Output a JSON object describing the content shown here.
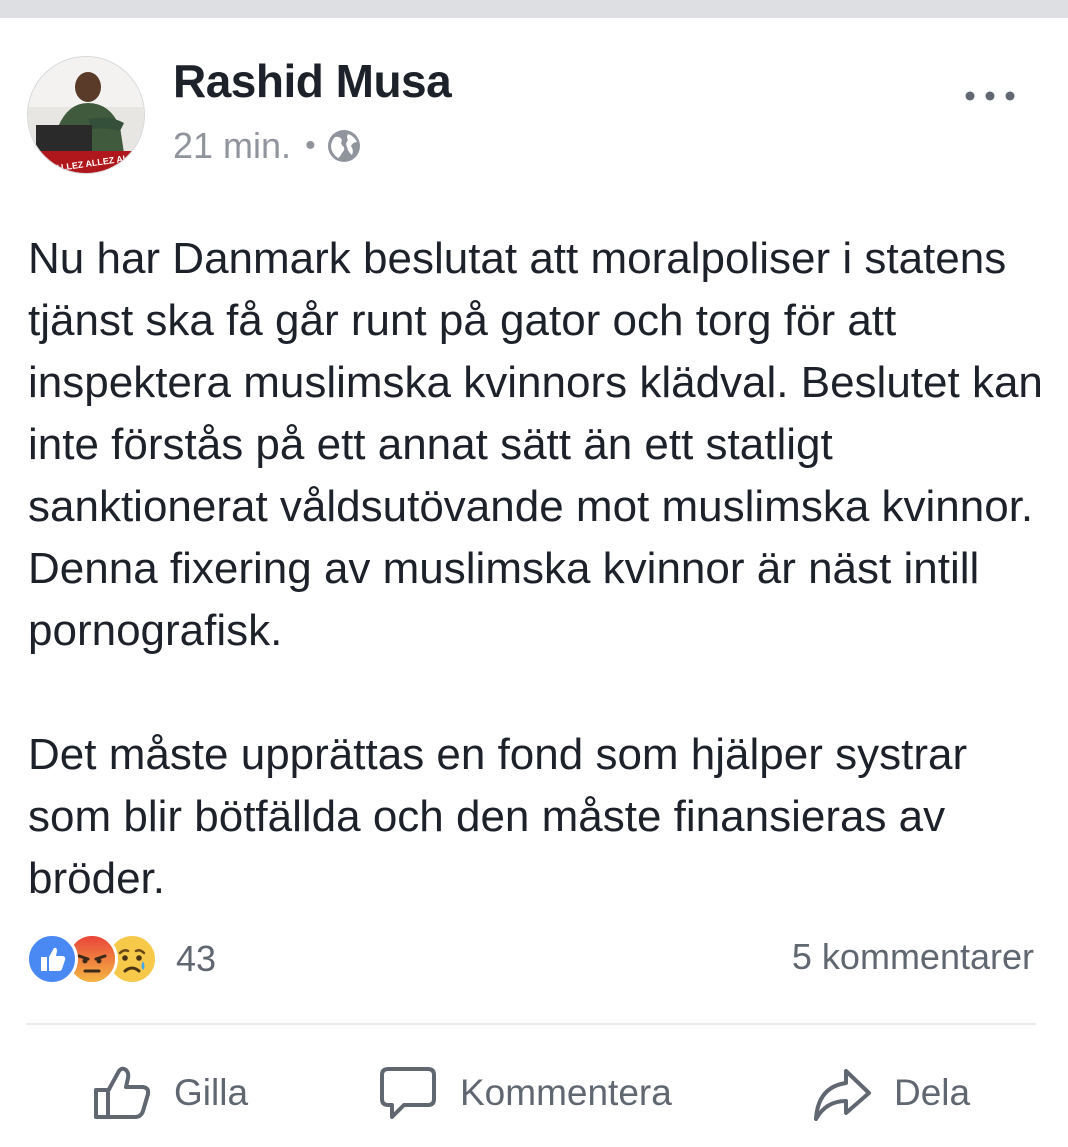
{
  "post": {
    "author": "Rashid Musa",
    "time": "21 min.",
    "separator": "•",
    "privacy_icon": "globe-icon",
    "more_icon": "more-options-icon",
    "avatar_banner_text": "ALLEZ ALLEZ ALL",
    "paragraphs": [
      "Nu har Danmark beslutat att moralpoliser i statens tjänst ska få går runt på gator och torg för att inspektera muslimska kvinnors klädval. Beslutet kan inte förstås på ett annat sätt än ett statligt sanktionerat våldsutövande mot muslimska kvinnor. Denna fixering av muslimska kvinnor är näst intill pornografisk.",
      "Det måste upprättas en fond som hjälper systrar som blir bötfällda och den måste finansieras av bröder."
    ]
  },
  "reactions": {
    "icons": [
      "like-reaction-icon",
      "angry-reaction-icon",
      "sad-reaction-icon"
    ],
    "count": "43",
    "comments": "5 kommentarer"
  },
  "actions": {
    "like": "Gilla",
    "comment": "Kommentera",
    "share": "Dela"
  },
  "colors": {
    "like_blue": "#4267b2",
    "angry_red": "#e9453a",
    "sad_yellow": "#f7c94b",
    "text": "#1d2129",
    "muted": "#90949c"
  }
}
